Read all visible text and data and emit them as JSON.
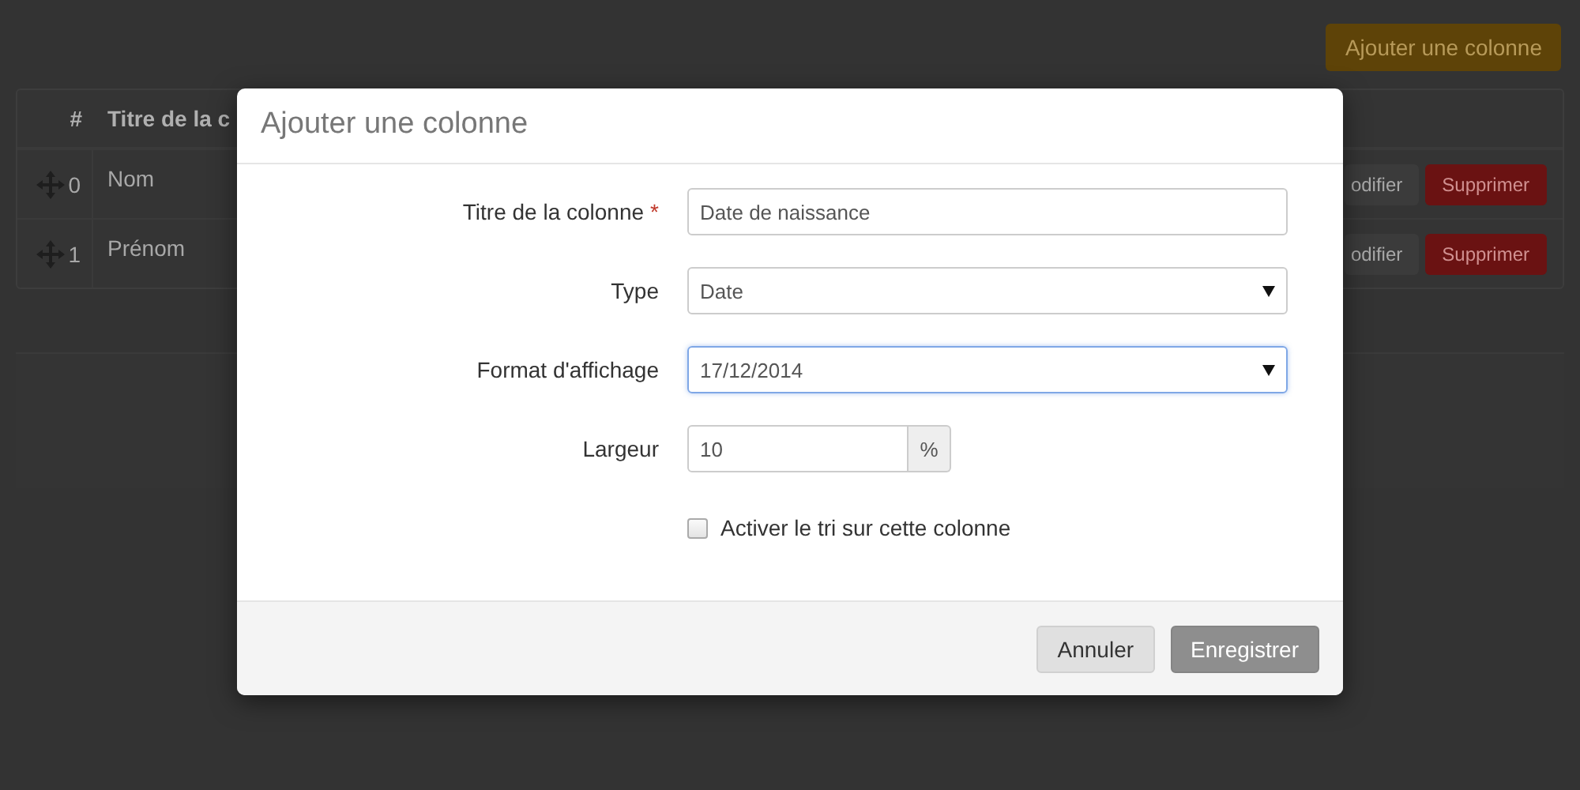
{
  "page": {
    "add_button": "Ajouter une colonne",
    "table": {
      "columns": [
        "#",
        "Titre de la c"
      ],
      "rows": [
        {
          "index": "0",
          "title": "Nom",
          "edit": "odifier",
          "delete": "Supprimer"
        },
        {
          "index": "1",
          "title": "Prénom",
          "edit": "odifier",
          "delete": "Supprimer"
        }
      ]
    }
  },
  "modal": {
    "title": "Ajouter une colonne",
    "fields": [
      {
        "kind": "text",
        "label": "Titre de la colonne",
        "required_mark": "*",
        "value": "Date de naissance",
        "focused": false
      },
      {
        "kind": "select",
        "label": "Type",
        "value": "Date",
        "focused": false
      },
      {
        "kind": "select",
        "label": "Format d'affichage",
        "value": "17/12/2014",
        "focused": true
      },
      {
        "kind": "addon",
        "label": "Largeur",
        "value": "10",
        "addon": "%",
        "focused": false
      },
      {
        "kind": "checkbox",
        "label": "Activer le tri sur cette colonne",
        "checked": false
      }
    ],
    "buttons": [
      {
        "label": "Annuler",
        "kind": "default"
      },
      {
        "label": "Enregistrer",
        "kind": "primary"
      }
    ]
  }
}
